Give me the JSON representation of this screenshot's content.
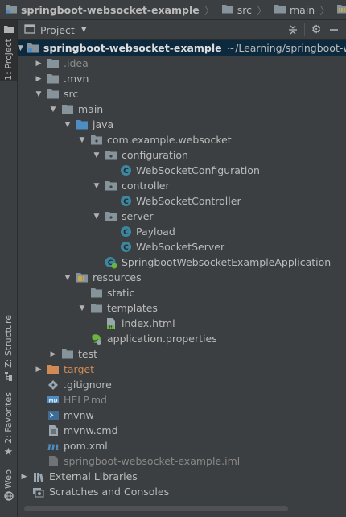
{
  "breadcrumb": {
    "items": [
      "springboot-websocket-example",
      "src",
      "main",
      "resources"
    ]
  },
  "left_stripe": {
    "project": "1: Project",
    "structure": "Z: Structure",
    "favorites": "2: Favorites",
    "web": "Web"
  },
  "panel": {
    "title": "Project"
  },
  "tree": [
    {
      "depth": 0,
      "arrow": "open",
      "icon": "module-folder-icon",
      "label": "springboot-websocket-example",
      "path": "~/Learning/springboot-w",
      "style": "bold",
      "selected": true
    },
    {
      "depth": 1,
      "arrow": "closed",
      "icon": "folder-icon",
      "label": ".idea",
      "style": "muted"
    },
    {
      "depth": 1,
      "arrow": "closed",
      "icon": "folder-icon",
      "label": ".mvn"
    },
    {
      "depth": 1,
      "arrow": "open",
      "icon": "folder-icon",
      "label": "src"
    },
    {
      "depth": 2,
      "arrow": "open",
      "icon": "folder-icon",
      "label": "main"
    },
    {
      "depth": 3,
      "arrow": "open",
      "icon": "source-folder-icon",
      "label": "java"
    },
    {
      "depth": 4,
      "arrow": "open",
      "icon": "package-icon",
      "label": "com.example.websocket"
    },
    {
      "depth": 5,
      "arrow": "open",
      "icon": "package-icon",
      "label": "configuration"
    },
    {
      "depth": 6,
      "arrow": "none",
      "icon": "class-icon",
      "label": "WebSocketConfiguration"
    },
    {
      "depth": 5,
      "arrow": "open",
      "icon": "package-icon",
      "label": "controller"
    },
    {
      "depth": 6,
      "arrow": "none",
      "icon": "class-icon",
      "label": "WebSocketController"
    },
    {
      "depth": 5,
      "arrow": "open",
      "icon": "package-icon",
      "label": "server"
    },
    {
      "depth": 6,
      "arrow": "none",
      "icon": "class-icon",
      "label": "Payload"
    },
    {
      "depth": 6,
      "arrow": "none",
      "icon": "class-icon",
      "label": "WebSocketServer"
    },
    {
      "depth": 5,
      "arrow": "none",
      "icon": "spring-class-icon",
      "label": "SpringbootWebsocketExampleApplication"
    },
    {
      "depth": 3,
      "arrow": "open",
      "icon": "resources-folder-icon",
      "label": "resources"
    },
    {
      "depth": 4,
      "arrow": "none",
      "icon": "folder-icon",
      "label": "static"
    },
    {
      "depth": 4,
      "arrow": "open",
      "icon": "folder-icon",
      "label": "templates"
    },
    {
      "depth": 5,
      "arrow": "none",
      "icon": "html-file-icon",
      "label": "index.html"
    },
    {
      "depth": 4,
      "arrow": "none",
      "icon": "spring-properties-icon",
      "label": "application.properties"
    },
    {
      "depth": 2,
      "arrow": "closed",
      "icon": "folder-icon",
      "label": "test"
    },
    {
      "depth": 1,
      "arrow": "closed",
      "icon": "excluded-folder-icon",
      "label": "target",
      "style": "orange"
    },
    {
      "depth": 1,
      "arrow": "none",
      "icon": "git-file-icon",
      "label": ".gitignore"
    },
    {
      "depth": 1,
      "arrow": "none",
      "icon": "markdown-file-icon",
      "label": "HELP.md",
      "style": "muted"
    },
    {
      "depth": 1,
      "arrow": "none",
      "icon": "terminal-file-icon",
      "label": "mvnw"
    },
    {
      "depth": 1,
      "arrow": "none",
      "icon": "text-file-icon",
      "label": "mvnw.cmd"
    },
    {
      "depth": 1,
      "arrow": "none",
      "icon": "maven-file-icon",
      "label": "pom.xml"
    },
    {
      "depth": 1,
      "arrow": "none",
      "icon": "iml-file-icon",
      "label": "springboot-websocket-example.iml",
      "style": "dim"
    },
    {
      "depth": 0,
      "arrow": "closed",
      "icon": "libraries-icon",
      "label": "External Libraries"
    },
    {
      "depth": 0,
      "arrow": "none",
      "icon": "scratches-icon",
      "label": "Scratches and Consoles"
    }
  ],
  "colors": {
    "folder": "#87939a",
    "source_folder": "#4e8dc4",
    "class": "#3e86a0",
    "spring": "#6db33f",
    "selection": "#0d293e",
    "excluded": "#d08a56"
  }
}
